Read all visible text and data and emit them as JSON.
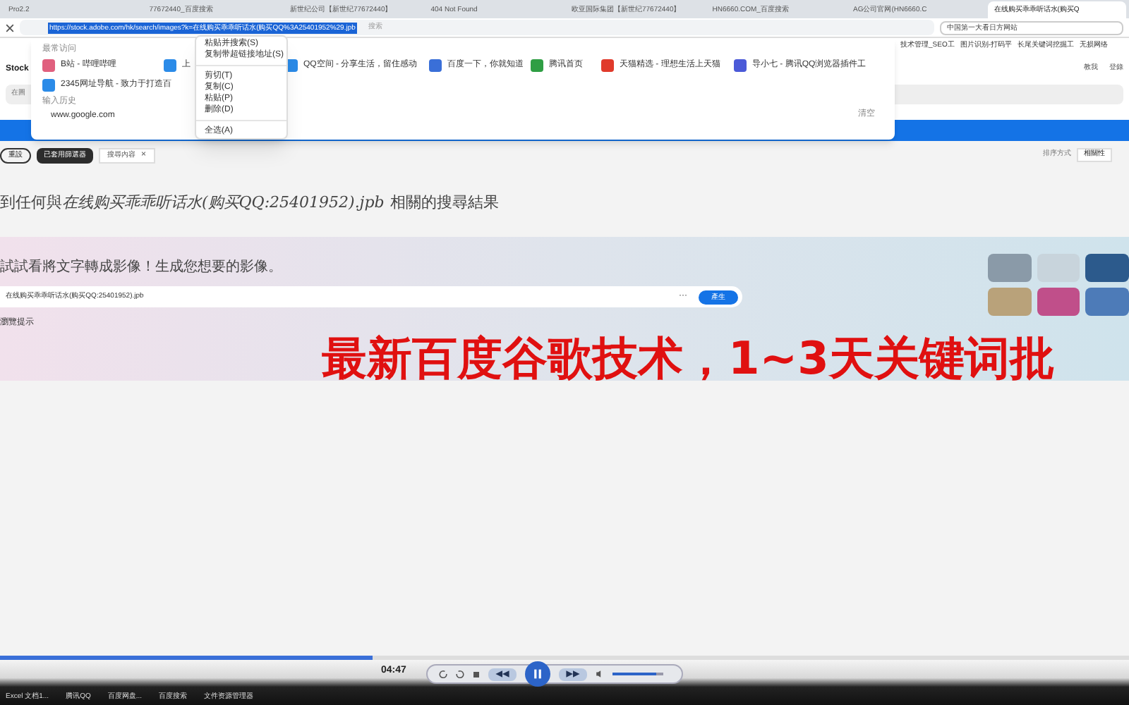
{
  "browser": {
    "tabs": [
      {
        "label": "Pro2.2",
        "selected": false
      },
      {
        "label": "77672440_百度搜索",
        "selected": false
      },
      {
        "label": "新世纪公司【新世纪77672440】",
        "selected": false
      },
      {
        "label": "404 Not Found",
        "selected": false
      },
      {
        "label": "欧亚国际集团【新世纪77672440】",
        "selected": false
      },
      {
        "label": "HN6660.COM_百度搜索",
        "selected": false
      },
      {
        "label": "AG公司官网(HN6660.C",
        "selected": false
      },
      {
        "label": "在线购买乖乖听话水(购买Q",
        "selected": true
      }
    ],
    "address": "https://stock.adobe.com/hk/search/images?k=在线购买乖乖听话水(购买QQ%3A25401952%29.jpb",
    "address_hint": "搜索",
    "search_box": "中国第一大看日方网站",
    "bookmarks": [
      "技术管理_SEO工",
      "图片识别-打码平",
      "长尾关键词挖掘工",
      "无损网络"
    ]
  },
  "suggest_panel": {
    "heading": "最常访问",
    "sites": [
      {
        "label": "B站 - 哔哩哔哩",
        "color": "#e0607e"
      },
      {
        "label": "上",
        "color": "#2b8be8"
      },
      {
        "label": "QQ空间 - 分享生活，留住感动",
        "color": "#2b8be8"
      },
      {
        "label": "百度一下，你就知道",
        "color": "#3a6fd8"
      },
      {
        "label": "腾讯首页",
        "color": "#2f9e44"
      },
      {
        "label": "天猫精选 - 理想生活上天猫",
        "color": "#e03a2b"
      },
      {
        "label": "导小七 - 腾讯QQ浏览器插件工",
        "color": "#4b5ad8"
      },
      {
        "label": "2345网址导航 - 致力于打造百",
        "color": "#2b8be8"
      }
    ],
    "history_heading": "输入历史",
    "history": [
      "www.google.com"
    ],
    "footer": "清空"
  },
  "context_menu": {
    "items": [
      {
        "label": "粘贴并搜索(S)",
        "kind": "item"
      },
      {
        "label": "复制带超链接地址(S)",
        "kind": "item"
      },
      {
        "kind": "separator"
      },
      {
        "label": "剪切(T)",
        "kind": "item"
      },
      {
        "label": "复制(C)",
        "kind": "item"
      },
      {
        "label": "粘贴(P)",
        "kind": "item"
      },
      {
        "label": "删除(D)",
        "kind": "item"
      },
      {
        "kind": "separator"
      },
      {
        "label": "全选(A)",
        "kind": "item"
      }
    ]
  },
  "page": {
    "logo": "Stock",
    "nav": [
      "教我",
      "登錄"
    ],
    "search_placeholder": "在圖",
    "filters": [
      {
        "label": "重設",
        "kind": "outline"
      },
      {
        "label": "已套用篩選器",
        "kind": "dark"
      },
      {
        "label": "搜尋內容",
        "kind": "removable",
        "close": "×"
      }
    ],
    "sort_label": "排序方式",
    "sort_value": "相關性",
    "results_heading": "到任何與 *在线购买乖乖听话水(购买QQ:25401952).jpb* 相關的搜尋結果",
    "generate": {
      "title": "試試看將文字轉成影像！生成您想要的影像。",
      "value": "在线购买乖乖听话水(购买QQ:25401952).jpb",
      "more": "···",
      "button": "產生",
      "tip": "瀏覽提示"
    }
  },
  "overlay_caption": "最新百度谷歌技术，1~3天关键词批",
  "player": {
    "level": 0.33,
    "time": "04:47",
    "volume": {
      "level": 0.85
    }
  },
  "taskbar": {
    "items": [
      "Excel 文档1...",
      "腾讯QQ",
      "百度网盘...",
      "百度搜索",
      "文件资源管理器"
    ]
  }
}
